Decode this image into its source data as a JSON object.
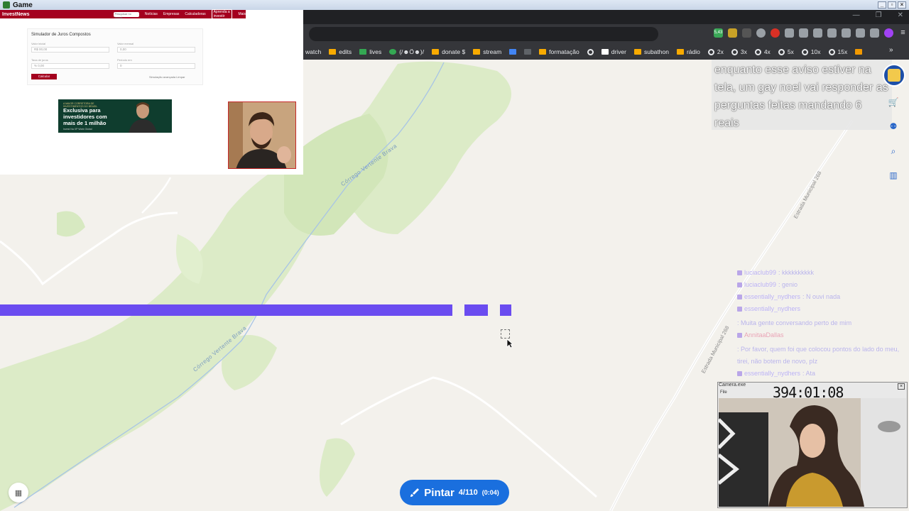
{
  "window": {
    "title": "Game"
  },
  "browser": {
    "bookmarks": [
      "watch",
      "edits",
      "lives",
      "(/☻Ö☻)/",
      "donate $",
      "stream",
      "formatação",
      "driver",
      "subathon",
      "rádio",
      "2x",
      "3x",
      "4x",
      "5x",
      "10x",
      "15x"
    ],
    "more_bookmarks": "»",
    "extension_badge": "5,43"
  },
  "notice": {
    "text": "enquanto esse aviso estiver na tela, um gay noel vai responder as perguntas feitas mandando 6 reais"
  },
  "chat": [
    {
      "user": "luciaclub99",
      "text": ": kkkkkkkkkk"
    },
    {
      "user": "luciaclub99",
      "text": ": genio"
    },
    {
      "user": "essentially_nydhers",
      "text": ": N ouvi nada"
    },
    {
      "user": "essentially_nydhers",
      "text": ": Muita gente conversando perto de mim"
    },
    {
      "user": "AnnitaaDallas",
      "text": ": Por favor, quem foi que colocou pontos do lado do meu, tirei, não botem de novo, plz"
    },
    {
      "user": "essentially_nydhers",
      "text": ": Ata"
    }
  ],
  "webcam": {
    "title": "Camera.exe",
    "menu": "File",
    "timer": "394:01:08",
    "close": "×"
  },
  "map": {
    "labels": [
      "Córrego Vertente Brava",
      "Córrego Vertente Brava",
      "Estrada Municipal 268",
      "Estrada Municipal 268"
    ],
    "stroke_color": "#6a4cf0"
  },
  "paint_button": {
    "label": "Pintar",
    "count": "4/110",
    "time": "(0:04)"
  },
  "overlay_site": {
    "logo": "InvestNews",
    "nav": [
      "Notícias",
      "Empresas",
      "Calculadoras",
      "Aprenda a investir",
      "Mais"
    ],
    "cta": "Aprenda a investir",
    "search_placeholder": "Pesquisar no Invest...",
    "sim_title": "Simulador de Juros Compostos",
    "fields": [
      {
        "label": "Valor inicial",
        "value": "R$ 00,00"
      },
      {
        "label": "Valor mensal",
        "value": "0,00"
      },
      {
        "label": "Taxa de juros",
        "value": "% 0,00"
      },
      {
        "label": "Período em",
        "value": "0"
      }
    ],
    "calc_button": "Calcular",
    "clear": "Simulação avançada   Limpar",
    "ad": {
      "small": "A MAIOR CORRETORA DE INVESTIMENTOS DO BRASIL",
      "headline": "Exclusiva para investidores com mais de 1 milhão",
      "tiny": "Invest Na XP Work Global"
    }
  }
}
